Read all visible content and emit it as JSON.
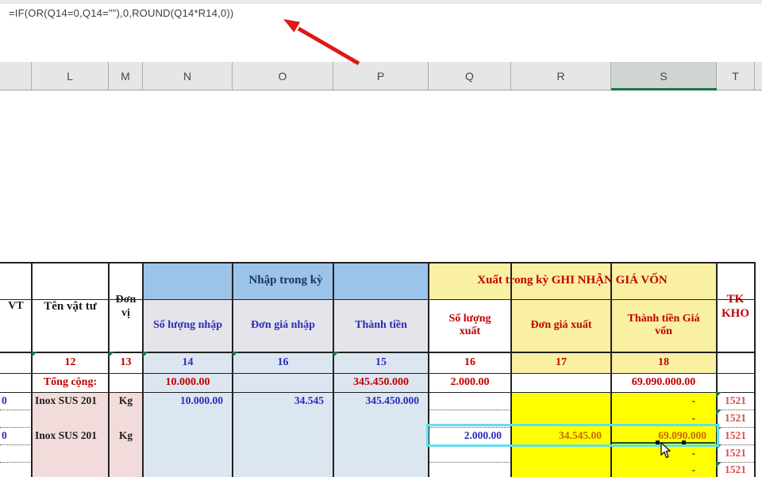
{
  "formula_bar": {
    "formula": "=IF(OR(Q14=0,Q14=\"\"),0,ROUND(Q14*R14,0))"
  },
  "column_headers": {
    "letters": [
      "L",
      "M",
      "N",
      "O",
      "P",
      "Q",
      "R",
      "S",
      "T"
    ],
    "selected_letter": "S"
  },
  "table": {
    "headers": {
      "material_code": "VT",
      "material_name": "Tên vật tư",
      "unit": "Đơn vị",
      "import_group": "Nhập trong kỳ",
      "import_qty": "Số lượng nhập",
      "import_price": "Đơn giá nhập",
      "import_amount": "Thành tiền",
      "export_group": "Xuất trong kỳ GHI NHẬN GIÁ VỐN",
      "export_qty": "Số lượng xuất",
      "export_price": "Đơn giá xuất",
      "export_amount": "Thành tiền Giá vốn",
      "stock_account": "TK KHO"
    },
    "number_row": [
      "",
      "12",
      "13",
      "14",
      "16",
      "15",
      "16",
      "17",
      "18",
      ""
    ],
    "total_row": [
      "",
      "Tổng cộng:",
      "",
      "10.000.00",
      "",
      "345.450.000",
      "2.000.00",
      "",
      "69.090.000.00",
      ""
    ],
    "data_rows": [
      [
        "0",
        "Inox SUS 201",
        "Kg",
        "10.000.00",
        "34.545",
        "345.450.000",
        "",
        "",
        "-",
        "1521"
      ],
      [
        "",
        "",
        "",
        "",
        "",
        "",
        "",
        "",
        "-",
        "1521"
      ],
      [
        "0",
        "Inox SUS 201",
        "Kg",
        "",
        "",
        "",
        "2.000.00",
        "34.545.00",
        "69.090.000",
        "1521"
      ],
      [
        "",
        "",
        "",
        "",
        "",
        "",
        "",
        "",
        "-",
        "1521"
      ],
      [
        "",
        "",
        "",
        "",
        "",
        "",
        "",
        "",
        "-",
        "1521"
      ]
    ],
    "highlighted_row_index": 2
  },
  "colors": {
    "import_header_bg": "#9CC3E8",
    "import_header_text": "#17365D",
    "export_header_bg": "#FAF0A2",
    "import_data_bg": "#DCE6F1",
    "export_data_bg": "#FFFF00",
    "material_data_bg": "#F2DCDB",
    "red_text": "#C00000",
    "blue_text": "#2B2BBD",
    "orange_text": "#C96A00",
    "account_text": "#D85050",
    "selection_cyan": "#5FDFEF",
    "excel_green": "#217346"
  }
}
